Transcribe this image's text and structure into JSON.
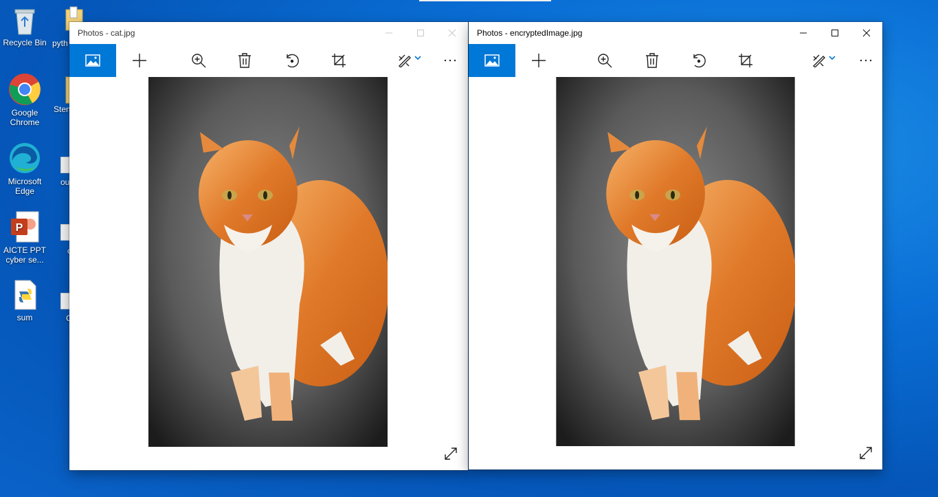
{
  "desktop": {
    "icons": [
      {
        "label": "Recycle Bin",
        "icon": "recycle-bin-icon"
      },
      {
        "label": "Google Chrome",
        "icon": "chrome-icon"
      },
      {
        "label": "Microsoft Edge",
        "icon": "edge-icon"
      },
      {
        "label": "AICTE PPT cyber se...",
        "icon": "powerpoint-icon"
      },
      {
        "label": "sum",
        "icon": "python-file-icon"
      }
    ],
    "partial_labels": [
      "pyth",
      "Sten",
      "ou",
      "c",
      "C"
    ]
  },
  "windows": [
    {
      "title": "Photos - cat.jpg",
      "state": "inactive",
      "toolbar": [
        "image-icon",
        "add-icon",
        "zoom-in-icon",
        "delete-icon",
        "rotate-icon",
        "crop-icon",
        "edit-icon",
        "chevron-down-icon",
        "more-icon"
      ],
      "image": "cat photo"
    },
    {
      "title": "Photos - encryptedImage.jpg",
      "state": "active",
      "toolbar": [
        "image-icon",
        "add-icon",
        "zoom-in-icon",
        "delete-icon",
        "rotate-icon",
        "crop-icon",
        "edit-icon",
        "chevron-down-icon",
        "more-icon"
      ],
      "image": "cat photo"
    }
  ],
  "colors": {
    "accent": "#0078d7",
    "desktop": "#0a6fd6"
  }
}
